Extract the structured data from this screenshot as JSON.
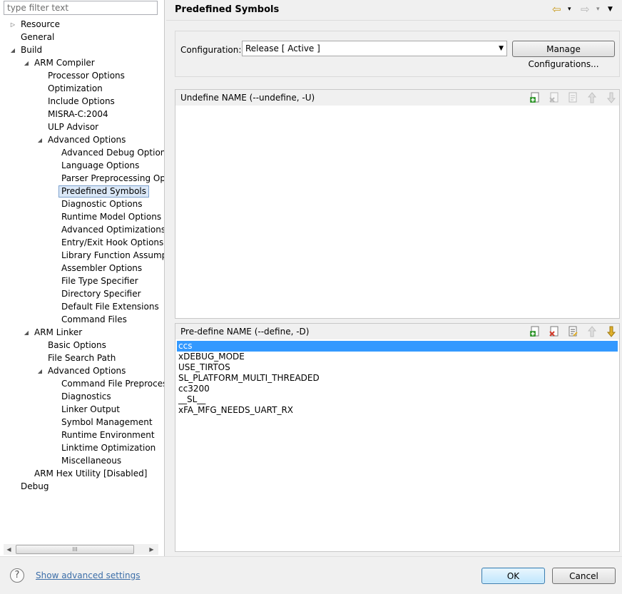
{
  "filter": {
    "placeholder": "type filter text"
  },
  "tree": [
    {
      "label": "Resource",
      "toggle": "▷"
    },
    {
      "label": "General",
      "toggle": ""
    },
    {
      "label": "Build",
      "toggle": "◢"
    },
    {
      "label": "ARM Compiler",
      "toggle": "◢"
    },
    {
      "label": "Processor Options",
      "toggle": ""
    },
    {
      "label": "Optimization",
      "toggle": ""
    },
    {
      "label": "Include Options",
      "toggle": ""
    },
    {
      "label": "MISRA-C:2004",
      "toggle": ""
    },
    {
      "label": "ULP Advisor",
      "toggle": ""
    },
    {
      "label": "Advanced Options",
      "toggle": "◢"
    },
    {
      "label": "Advanced Debug Options",
      "toggle": ""
    },
    {
      "label": "Language Options",
      "toggle": ""
    },
    {
      "label": "Parser Preprocessing Opti",
      "toggle": ""
    },
    {
      "label": "Predefined Symbols",
      "toggle": "",
      "selected": true
    },
    {
      "label": "Diagnostic Options",
      "toggle": ""
    },
    {
      "label": "Runtime Model Options",
      "toggle": ""
    },
    {
      "label": "Advanced Optimizations",
      "toggle": ""
    },
    {
      "label": "Entry/Exit Hook Options",
      "toggle": ""
    },
    {
      "label": "Library Function Assumpt",
      "toggle": ""
    },
    {
      "label": "Assembler Options",
      "toggle": ""
    },
    {
      "label": "File Type Specifier",
      "toggle": ""
    },
    {
      "label": "Directory Specifier",
      "toggle": ""
    },
    {
      "label": "Default File Extensions",
      "toggle": ""
    },
    {
      "label": "Command Files",
      "toggle": ""
    },
    {
      "label": "ARM Linker",
      "toggle": "◢"
    },
    {
      "label": "Basic Options",
      "toggle": ""
    },
    {
      "label": "File Search Path",
      "toggle": ""
    },
    {
      "label": "Advanced Options",
      "toggle": "◢"
    },
    {
      "label": "Command File Preprocess",
      "toggle": ""
    },
    {
      "label": "Diagnostics",
      "toggle": ""
    },
    {
      "label": "Linker Output",
      "toggle": ""
    },
    {
      "label": "Symbol Management",
      "toggle": ""
    },
    {
      "label": "Runtime Environment",
      "toggle": ""
    },
    {
      "label": "Linktime Optimization",
      "toggle": ""
    },
    {
      "label": "Miscellaneous",
      "toggle": ""
    },
    {
      "label": "ARM Hex Utility  [Disabled]",
      "toggle": ""
    },
    {
      "label": "Debug",
      "toggle": ""
    }
  ],
  "scrollbar": {
    "thumb_grip": "III",
    "left_arrow": "◀",
    "right_arrow": "▶"
  },
  "header": {
    "title": "Predefined Symbols",
    "back_icon": "⇦",
    "dropdown_icon": "▾",
    "forward_icon": "⇨",
    "menu_icon": "▼"
  },
  "config": {
    "label": "Configuration:",
    "selected": "Release  [ Active ]",
    "dropdown_arrow": "▼",
    "manage_button": "Manage Configurations..."
  },
  "undefine_panel": {
    "title": "Undefine NAME (--undefine, -U)",
    "items": []
  },
  "predefine_panel": {
    "title": "Pre-define NAME (--define, -D)",
    "items": [
      "ccs",
      "xDEBUG_MODE",
      "USE_TIRTOS",
      "SL_PLATFORM_MULTI_THREADED",
      "cc3200",
      "__SL__",
      "xFA_MFG_NEEDS_UART_RX"
    ],
    "selected_index": 0
  },
  "footer": {
    "help_icon": "?",
    "advanced_link": "Show advanced settings",
    "ok_button": "OK",
    "cancel_button": "Cancel"
  },
  "colors": {
    "selection": "#3399ff",
    "link": "#3c6ea8",
    "add": "#3a9b36",
    "delete": "#d23b2b",
    "move": "#e0b02c"
  }
}
